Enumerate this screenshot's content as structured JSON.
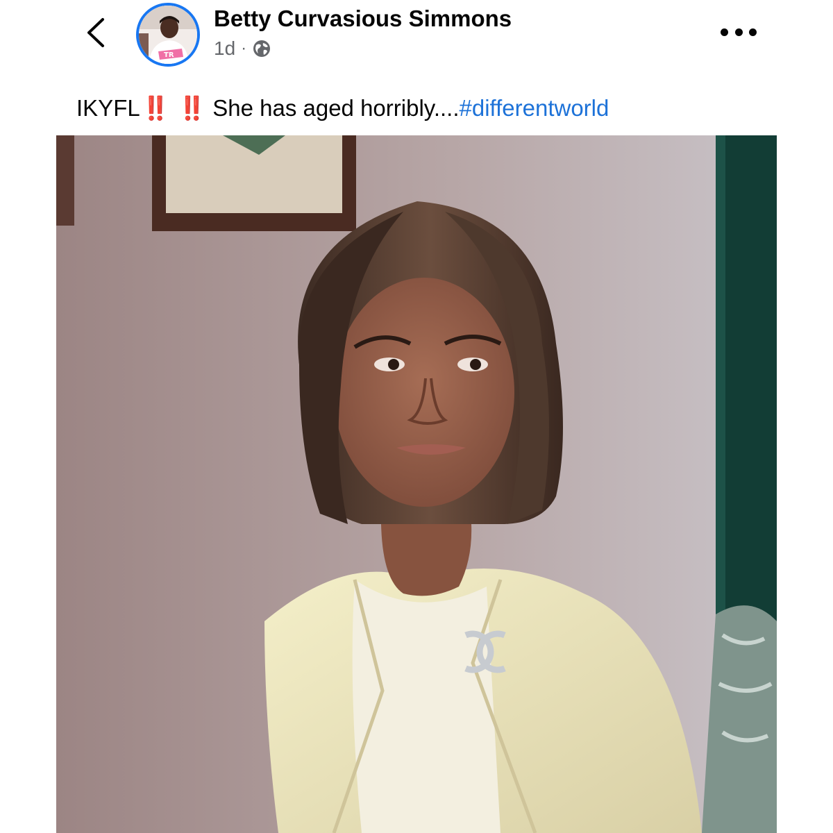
{
  "header": {
    "author_name": "Betty Curvasious Simmons",
    "timestamp": "1d",
    "separator": "·",
    "privacy_icon": "globe-icon",
    "back_icon": "chevron-left-icon",
    "more_icon": "more-horizontal-icon"
  },
  "post": {
    "text_prefix": "IKYFL",
    "emoji_1": "‼️",
    "emoji_2": "‼️",
    "text_body": "She has aged horribly....",
    "hashtag": "#differentworld"
  },
  "colors": {
    "avatar_ring": "#1877f2",
    "hashtag": "#1d72d8",
    "emoji": "#e0241b",
    "meta_text": "#65676b"
  }
}
